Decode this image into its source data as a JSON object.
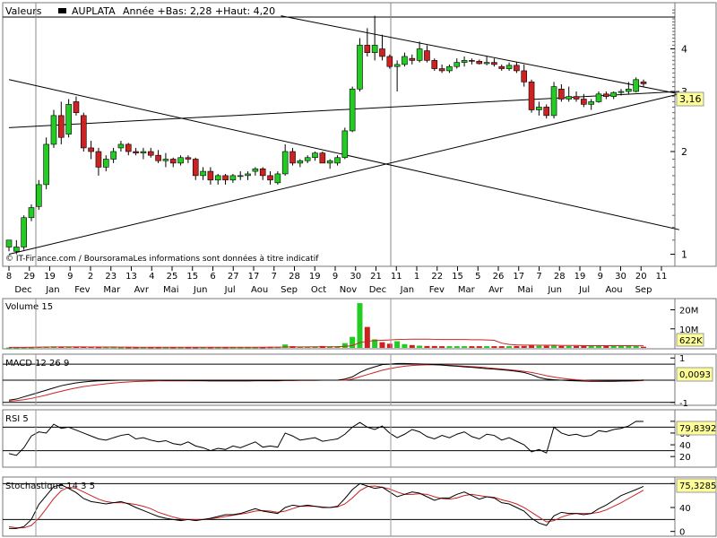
{
  "header": {
    "label": "Valeurs",
    "symbol": "AUPLATA",
    "stats": "Année +Bas: 2,28 +Haut: 4,20"
  },
  "watermark": "© IT-Finance.com / BoursoramaLes informations sont données à titre indicatif",
  "colors": {
    "up": "#22cc22",
    "down": "#cc2222",
    "signal": "#cc2222",
    "line": "#000000",
    "badge": "#ffff99",
    "panel_bg": "#ffffff",
    "axis_bg": "#eef0f5"
  },
  "date_axis": {
    "days": [
      "8",
      "29",
      "19",
      "9",
      "2",
      "23",
      "13",
      "4",
      "25",
      "15",
      "6",
      "27",
      "17",
      "7",
      "28",
      "19",
      "9",
      "30",
      "21",
      "11",
      "1",
      "22",
      "15",
      "5",
      "26",
      "17",
      "7",
      "28",
      "19",
      "9",
      "30",
      "20",
      "11"
    ],
    "months": [
      "Dec",
      "Jan",
      "Fev",
      "Mar",
      "Avr",
      "Mai",
      "Jun",
      "Jul",
      "Aou",
      "Sep",
      "Oct",
      "Nov",
      "Dec",
      "Jan",
      "Fev",
      "Mar",
      "Avr",
      "Mai",
      "Jun",
      "Jul",
      "Aou",
      "Sep"
    ]
  },
  "price_panel": {
    "y_ticks": [
      "4",
      "3",
      "2",
      "1"
    ],
    "last_label": "3,16"
  },
  "volume_panel": {
    "title": "Volume 15",
    "y_ticks": [
      "20M",
      "10M"
    ],
    "last_label": "622K"
  },
  "macd_panel": {
    "title": "MACD 12 26 9",
    "y_ticks": [
      "1",
      "-1"
    ],
    "last_label": "0,0093"
  },
  "rsi_panel": {
    "title": "RSI 5",
    "y_ticks": [
      "80",
      "60",
      "40",
      "20"
    ],
    "last_label": "79,8392"
  },
  "stoch_panel": {
    "title": "Stochastique 14 3 5",
    "y_ticks": [
      "80",
      "40",
      "0"
    ],
    "last_label": "75,3285"
  },
  "chart_data": {
    "type": "candlestick",
    "title": "AUPLATA",
    "scale": "log",
    "ylim": [
      0.95,
      5.3
    ],
    "note": "weekly candles, approximate, read from chart",
    "candles": [
      [
        1.05,
        1.1,
        1.02,
        1.1
      ],
      [
        1.02,
        1.1,
        1.0,
        1.05
      ],
      [
        1.05,
        1.3,
        1.03,
        1.28
      ],
      [
        1.28,
        1.4,
        1.25,
        1.37
      ],
      [
        1.38,
        1.65,
        1.35,
        1.6
      ],
      [
        1.6,
        2.2,
        1.55,
        2.1
      ],
      [
        2.1,
        2.65,
        2.05,
        2.55
      ],
      [
        2.55,
        2.8,
        2.1,
        2.2
      ],
      [
        2.25,
        2.85,
        2.2,
        2.75
      ],
      [
        2.8,
        2.9,
        2.55,
        2.6
      ],
      [
        2.55,
        2.6,
        2.0,
        2.05
      ],
      [
        2.05,
        2.15,
        1.9,
        2.0
      ],
      [
        2.0,
        2.05,
        1.7,
        1.8
      ],
      [
        1.8,
        1.95,
        1.75,
        1.9
      ],
      [
        1.9,
        2.05,
        1.85,
        2.0
      ],
      [
        2.05,
        2.15,
        2.0,
        2.1
      ],
      [
        2.1,
        2.12,
        1.95,
        2.0
      ],
      [
        2.0,
        2.05,
        1.95,
        1.98
      ],
      [
        1.98,
        2.05,
        1.9,
        2.0
      ],
      [
        2.0,
        2.05,
        1.92,
        1.95
      ],
      [
        1.95,
        2.02,
        1.85,
        1.88
      ],
      [
        1.88,
        1.98,
        1.8,
        1.9
      ],
      [
        1.9,
        1.92,
        1.8,
        1.85
      ],
      [
        1.85,
        1.95,
        1.82,
        1.92
      ],
      [
        1.92,
        1.95,
        1.85,
        1.9
      ],
      [
        1.9,
        1.92,
        1.65,
        1.7
      ],
      [
        1.7,
        1.8,
        1.65,
        1.75
      ],
      [
        1.75,
        1.8,
        1.6,
        1.65
      ],
      [
        1.65,
        1.72,
        1.6,
        1.7
      ],
      [
        1.7,
        1.72,
        1.6,
        1.65
      ],
      [
        1.65,
        1.72,
        1.62,
        1.7
      ],
      [
        1.7,
        1.75,
        1.65,
        1.7
      ],
      [
        1.7,
        1.75,
        1.65,
        1.72
      ],
      [
        1.75,
        1.8,
        1.7,
        1.78
      ],
      [
        1.78,
        1.8,
        1.65,
        1.7
      ],
      [
        1.7,
        1.75,
        1.6,
        1.65
      ],
      [
        1.62,
        1.75,
        1.6,
        1.72
      ],
      [
        1.72,
        2.1,
        1.7,
        2.0
      ],
      [
        2.0,
        2.05,
        1.82,
        1.85
      ],
      [
        1.85,
        1.9,
        1.8,
        1.88
      ],
      [
        1.88,
        1.95,
        1.85,
        1.92
      ],
      [
        1.92,
        2.0,
        1.88,
        1.98
      ],
      [
        1.98,
        2.0,
        1.85,
        1.85
      ],
      [
        1.85,
        1.9,
        1.78,
        1.88
      ],
      [
        1.85,
        1.95,
        1.82,
        1.92
      ],
      [
        1.92,
        2.35,
        1.9,
        2.3
      ],
      [
        2.3,
        3.1,
        2.28,
        3.05
      ],
      [
        3.05,
        4.3,
        3.0,
        4.1
      ],
      [
        4.1,
        4.6,
        3.8,
        3.9
      ],
      [
        3.9,
        5.0,
        3.7,
        4.1
      ],
      [
        4.0,
        4.4,
        3.7,
        3.8
      ],
      [
        3.8,
        3.85,
        3.5,
        3.55
      ],
      [
        3.55,
        3.7,
        3.0,
        3.6
      ],
      [
        3.6,
        3.9,
        3.55,
        3.8
      ],
      [
        3.75,
        3.85,
        3.6,
        3.7
      ],
      [
        3.7,
        4.2,
        3.65,
        4.0
      ],
      [
        3.95,
        4.1,
        3.65,
        3.7
      ],
      [
        3.7,
        3.75,
        3.45,
        3.5
      ],
      [
        3.5,
        3.6,
        3.4,
        3.45
      ],
      [
        3.45,
        3.6,
        3.4,
        3.55
      ],
      [
        3.55,
        3.75,
        3.5,
        3.65
      ],
      [
        3.65,
        3.8,
        3.55,
        3.7
      ],
      [
        3.7,
        3.75,
        3.6,
        3.68
      ],
      [
        3.68,
        3.72,
        3.6,
        3.62
      ],
      [
        3.62,
        3.8,
        3.58,
        3.65
      ],
      [
        3.65,
        3.75,
        3.55,
        3.6
      ],
      [
        3.55,
        3.6,
        3.45,
        3.5
      ],
      [
        3.5,
        3.65,
        3.45,
        3.58
      ],
      [
        3.58,
        3.65,
        3.4,
        3.45
      ],
      [
        3.45,
        3.6,
        3.1,
        3.2
      ],
      [
        3.2,
        3.25,
        2.6,
        2.65
      ],
      [
        2.65,
        2.8,
        2.55,
        2.7
      ],
      [
        2.7,
        2.75,
        2.5,
        2.55
      ],
      [
        2.55,
        3.2,
        2.5,
        3.1
      ],
      [
        3.05,
        3.15,
        2.8,
        2.85
      ],
      [
        2.85,
        3.1,
        2.8,
        2.9
      ],
      [
        2.9,
        3.0,
        2.8,
        2.85
      ],
      [
        2.85,
        2.95,
        2.7,
        2.75
      ],
      [
        2.75,
        2.85,
        2.65,
        2.8
      ],
      [
        2.8,
        3.0,
        2.78,
        2.95
      ],
      [
        2.95,
        3.0,
        2.85,
        2.9
      ],
      [
        2.9,
        3.0,
        2.85,
        2.98
      ],
      [
        2.98,
        3.05,
        2.92,
        3.0
      ],
      [
        3.0,
        3.2,
        2.95,
        3.05
      ],
      [
        3.0,
        3.3,
        2.98,
        3.25
      ],
      [
        3.2,
        3.25,
        3.1,
        3.16
      ]
    ],
    "trendlines": [
      {
        "from": [
          0,
          2.35
        ],
        "to": [
          112,
          3.0
        ]
      },
      {
        "from": [
          0,
          1.0
        ],
        "to": [
          112,
          2.95
        ]
      },
      {
        "from": [
          0,
          3.25
        ],
        "to": [
          112,
          1.18
        ]
      },
      {
        "from": [
          48,
          5.0
        ],
        "to": [
          112,
          2.95
        ]
      }
    ],
    "volume": [
      0.2,
      0.2,
      0.3,
      0.3,
      0.5,
      0.6,
      0.8,
      0.7,
      0.6,
      0.6,
      0.5,
      0.5,
      0.4,
      0.4,
      0.4,
      0.3,
      0.3,
      0.3,
      0.3,
      0.3,
      0.3,
      0.3,
      0.3,
      0.3,
      0.3,
      0.3,
      0.3,
      0.3,
      0.3,
      0.3,
      0.3,
      0.3,
      0.3,
      0.3,
      0.3,
      0.4,
      0.4,
      1.8,
      0.9,
      0.7,
      0.6,
      0.6,
      1.0,
      0.8,
      0.9,
      2.5,
      5.8,
      23.5,
      11.0,
      4.5,
      3.0,
      2.2,
      3.5,
      2.0,
      1.5,
      1.2,
      1.0,
      1.0,
      0.9,
      0.9,
      0.9,
      0.9,
      0.9,
      0.9,
      0.9,
      0.9,
      0.9,
      0.9,
      1.0,
      1.0,
      1.3,
      1.1,
      1.1,
      1.2,
      1.0,
      1.0,
      1.0,
      1.1,
      1.0,
      1.0,
      1.0,
      1.0,
      1.0,
      1.2,
      1.1,
      0.622
    ],
    "volume_ma": [
      0.3,
      0.3,
      0.3,
      0.35,
      0.4,
      0.45,
      0.5,
      0.55,
      0.55,
      0.55,
      0.55,
      0.5,
      0.5,
      0.45,
      0.45,
      0.4,
      0.4,
      0.35,
      0.35,
      0.35,
      0.35,
      0.35,
      0.35,
      0.35,
      0.35,
      0.35,
      0.35,
      0.35,
      0.35,
      0.35,
      0.35,
      0.35,
      0.35,
      0.35,
      0.35,
      0.4,
      0.4,
      0.5,
      0.55,
      0.55,
      0.55,
      0.6,
      0.6,
      0.6,
      0.65,
      0.8,
      1.2,
      2.8,
      3.5,
      3.8,
      4.0,
      4.2,
      4.4,
      4.5,
      4.6,
      4.6,
      4.6,
      4.5,
      4.4,
      4.4,
      4.4,
      4.4,
      4.3,
      4.3,
      4.2,
      4.0,
      2.5,
      1.8,
      1.6,
      1.5,
      1.5,
      1.4,
      1.4,
      1.4,
      1.3,
      1.3,
      1.3,
      1.2,
      1.2,
      1.2,
      1.2,
      1.2,
      1.2,
      1.2,
      1.1,
      1.1
    ],
    "macd": [
      -0.9,
      -0.85,
      -0.75,
      -0.65,
      -0.55,
      -0.45,
      -0.35,
      -0.25,
      -0.18,
      -0.12,
      -0.08,
      -0.05,
      -0.03,
      -0.02,
      -0.01,
      0.0,
      0.0,
      0.0,
      0.0,
      0.0,
      0.0,
      -0.01,
      -0.01,
      -0.01,
      -0.01,
      -0.02,
      -0.02,
      -0.03,
      -0.03,
      -0.03,
      -0.03,
      -0.03,
      -0.03,
      -0.02,
      -0.02,
      -0.02,
      -0.02,
      0.0,
      0.0,
      0.0,
      0.0,
      0.0,
      0.0,
      0.0,
      0.0,
      0.05,
      0.15,
      0.35,
      0.5,
      0.6,
      0.7,
      0.72,
      0.75,
      0.75,
      0.74,
      0.73,
      0.72,
      0.7,
      0.68,
      0.65,
      0.63,
      0.6,
      0.58,
      0.55,
      0.52,
      0.5,
      0.47,
      0.44,
      0.4,
      0.35,
      0.25,
      0.12,
      0.05,
      0.02,
      0.0,
      -0.02,
      -0.03,
      -0.04,
      -0.05,
      -0.05,
      -0.05,
      -0.05,
      -0.04,
      -0.03,
      -0.02,
      0.0093
    ],
    "macd_signal": [
      -0.95,
      -0.92,
      -0.88,
      -0.82,
      -0.75,
      -0.67,
      -0.58,
      -0.5,
      -0.42,
      -0.35,
      -0.29,
      -0.24,
      -0.2,
      -0.16,
      -0.13,
      -0.1,
      -0.08,
      -0.06,
      -0.05,
      -0.04,
      -0.03,
      -0.03,
      -0.03,
      -0.03,
      -0.03,
      -0.03,
      -0.03,
      -0.03,
      -0.03,
      -0.03,
      -0.03,
      -0.03,
      -0.03,
      -0.03,
      -0.03,
      -0.03,
      -0.03,
      -0.02,
      -0.02,
      -0.01,
      -0.01,
      -0.01,
      0.0,
      0.0,
      0.0,
      0.0,
      0.05,
      0.15,
      0.25,
      0.35,
      0.45,
      0.52,
      0.58,
      0.63,
      0.66,
      0.68,
      0.69,
      0.69,
      0.68,
      0.67,
      0.65,
      0.63,
      0.61,
      0.59,
      0.56,
      0.53,
      0.5,
      0.47,
      0.44,
      0.4,
      0.35,
      0.28,
      0.2,
      0.14,
      0.09,
      0.05,
      0.02,
      0.0,
      -0.02,
      -0.03,
      -0.04,
      -0.04,
      -0.04,
      -0.04,
      -0.03,
      -0.02
    ],
    "rsi": [
      25,
      22,
      35,
      55,
      62,
      60,
      75,
      68,
      70,
      65,
      60,
      55,
      50,
      48,
      52,
      56,
      58,
      50,
      52,
      48,
      45,
      47,
      42,
      40,
      45,
      38,
      35,
      30,
      34,
      32,
      38,
      35,
      40,
      45,
      36,
      38,
      36,
      60,
      55,
      48,
      50,
      52,
      46,
      48,
      50,
      58,
      70,
      78,
      70,
      66,
      72,
      60,
      52,
      58,
      66,
      62,
      54,
      50,
      56,
      52,
      58,
      62,
      54,
      50,
      58,
      56,
      48,
      52,
      46,
      40,
      28,
      32,
      26,
      70,
      60,
      56,
      58,
      54,
      56,
      64,
      62,
      66,
      68,
      72,
      80,
      79.8
    ],
    "stoch_k": [
      5,
      5,
      8,
      20,
      45,
      60,
      75,
      78,
      72,
      65,
      55,
      50,
      48,
      46,
      48,
      50,
      46,
      40,
      35,
      30,
      25,
      22,
      20,
      18,
      20,
      18,
      20,
      22,
      25,
      28,
      28,
      30,
      34,
      38,
      34,
      32,
      30,
      40,
      44,
      42,
      44,
      42,
      40,
      40,
      42,
      55,
      70,
      80,
      76,
      72,
      74,
      66,
      58,
      62,
      66,
      64,
      58,
      52,
      56,
      56,
      62,
      66,
      60,
      54,
      58,
      56,
      48,
      46,
      40,
      34,
      22,
      14,
      10,
      26,
      32,
      30,
      30,
      28,
      30,
      38,
      44,
      52,
      60,
      65,
      70,
      75.3
    ],
    "stoch_d": [
      8,
      6,
      6,
      10,
      22,
      38,
      55,
      68,
      74,
      72,
      66,
      60,
      54,
      50,
      48,
      48,
      47,
      45,
      42,
      38,
      32,
      28,
      24,
      21,
      20,
      20,
      20,
      21,
      23,
      25,
      27,
      29,
      31,
      34,
      35,
      34,
      32,
      34,
      38,
      42,
      42,
      42,
      41,
      40,
      41,
      46,
      56,
      68,
      75,
      76,
      74,
      71,
      66,
      62,
      62,
      63,
      62,
      58,
      55,
      54,
      56,
      60,
      62,
      60,
      58,
      57,
      53,
      50,
      46,
      40,
      32,
      24,
      16,
      18,
      24,
      28,
      30,
      30,
      30,
      32,
      36,
      42,
      48,
      55,
      62,
      69
    ]
  }
}
